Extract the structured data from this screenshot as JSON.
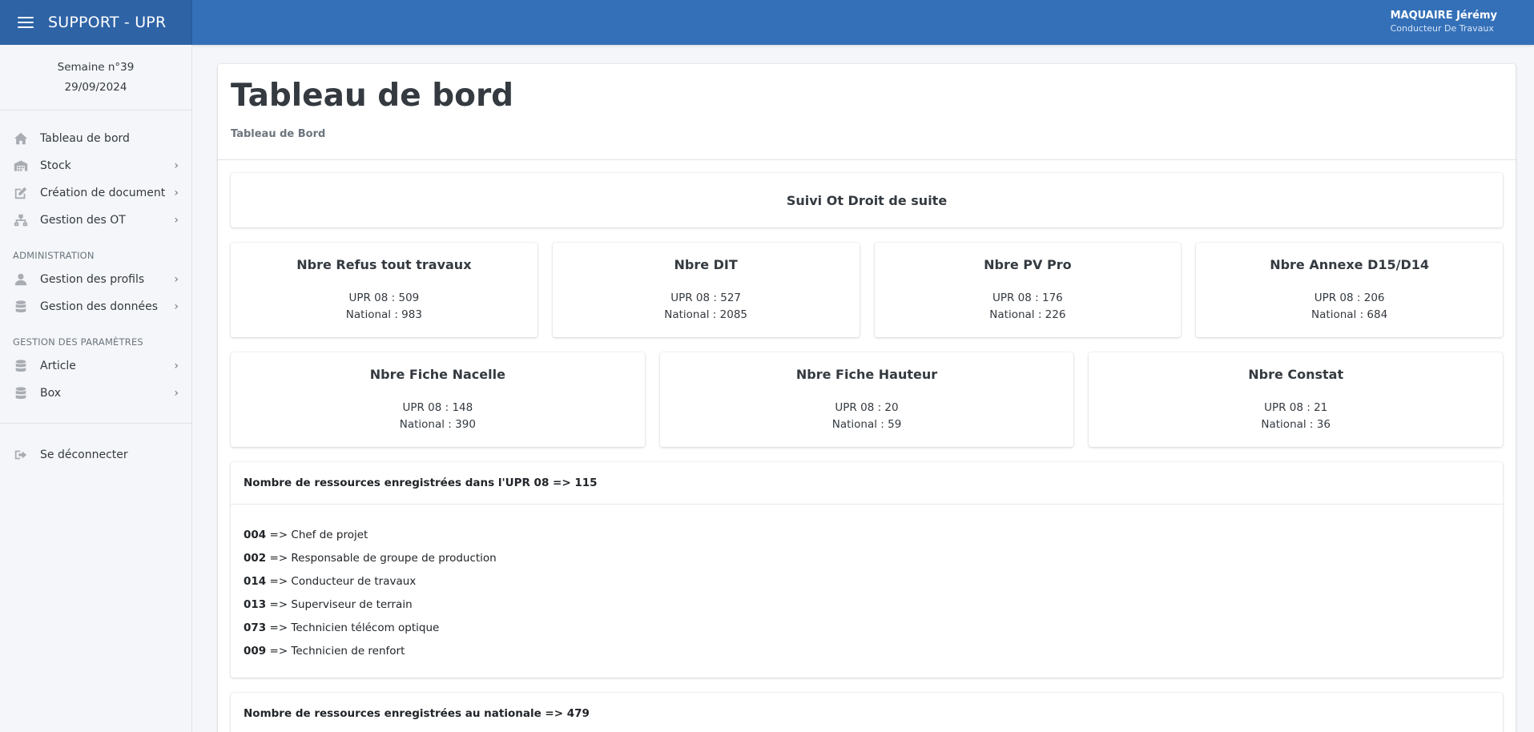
{
  "app": {
    "title": "SUPPORT - UPR"
  },
  "user": {
    "name": "MAQUAIRE Jérémy",
    "role": "Conducteur De Travaux"
  },
  "sidebar": {
    "week": "Semaine n°39",
    "date": "29/09/2024",
    "items": [
      {
        "label": "Tableau de bord",
        "icon": "home-icon"
      },
      {
        "label": "Stock",
        "icon": "warehouse-icon"
      },
      {
        "label": "Création de document",
        "icon": "edit-icon"
      },
      {
        "label": "Gestion des OT",
        "icon": "sitemap-icon"
      }
    ],
    "admin_section": "ADMINISTRATION",
    "admin_items": [
      {
        "label": "Gestion des profils",
        "icon": "user-icon"
      },
      {
        "label": "Gestion des données",
        "icon": "database-icon"
      }
    ],
    "params_section": "GESTION DES PARAMÈTRES",
    "params_items": [
      {
        "label": "Article",
        "icon": "database-icon"
      },
      {
        "label": "Box",
        "icon": "database-icon"
      }
    ],
    "logout": "Se déconnecter"
  },
  "page": {
    "title": "Tableau de bord",
    "subtitle": "Tableau de Bord",
    "section_title": "Suivi Ot Droit de suite"
  },
  "stats_row1": [
    {
      "title": "Nbre Refus tout travaux",
      "upr": "UPR 08 : 509",
      "national": "National : 983"
    },
    {
      "title": "Nbre DIT",
      "upr": "UPR 08 : 527",
      "national": "National : 2085"
    },
    {
      "title": "Nbre PV Pro",
      "upr": "UPR 08 : 176",
      "national": "National : 226"
    },
    {
      "title": "Nbre Annexe D15/D14",
      "upr": "UPR 08 : 206",
      "national": "National : 684"
    }
  ],
  "stats_row2": [
    {
      "title": "Nbre Fiche Nacelle",
      "upr": "UPR 08 : 148",
      "national": "National : 390"
    },
    {
      "title": "Nbre Fiche Hauteur",
      "upr": "UPR 08 : 20",
      "national": "National : 59"
    },
    {
      "title": "Nbre Constat",
      "upr": "UPR 08 : 21",
      "national": "National : 36"
    }
  ],
  "resources_upr": {
    "header": "Nombre de ressources enregistrées dans l'UPR 08 => 115",
    "rows": [
      {
        "code": "004",
        "text": " => Chef de projet"
      },
      {
        "code": "002",
        "text": " => Responsable de groupe de production"
      },
      {
        "code": "014",
        "text": " => Conducteur de travaux"
      },
      {
        "code": "013",
        "text": " => Superviseur de terrain"
      },
      {
        "code": "073",
        "text": " => Technicien télécom optique"
      },
      {
        "code": "009",
        "text": " => Technicien de renfort"
      }
    ]
  },
  "resources_national": {
    "header": "Nombre de ressources enregistrées au nationale => 479"
  }
}
